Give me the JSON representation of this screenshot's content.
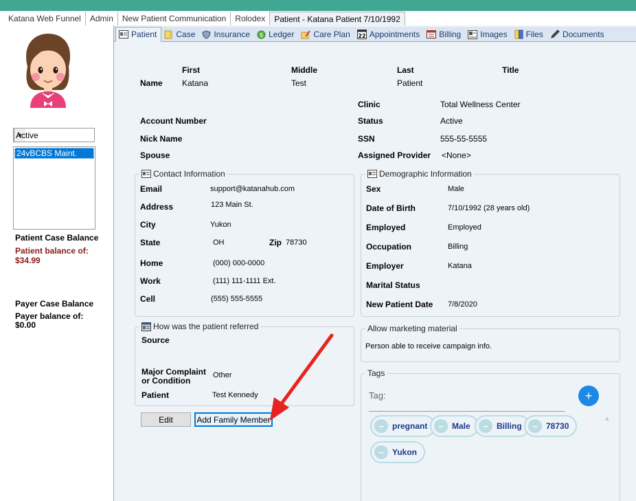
{
  "top_tabs": [
    {
      "label": "Katana Web Funnel"
    },
    {
      "label": "Admin"
    },
    {
      "label": "New Patient Communication"
    },
    {
      "label": "Rolodex"
    },
    {
      "label": "Patient - Katana Patient 7/10/1992"
    }
  ],
  "sidebar": {
    "status_value": "Active",
    "cases": [
      "24vBCBS Maint."
    ],
    "patient_balance_title": "Patient Case Balance",
    "patient_balance_text": "Patient balance of: $34.99",
    "payer_balance_title": "Payer Case Balance",
    "payer_balance_text": "Payer balance of: $0.00"
  },
  "sub_tabs": [
    {
      "label": "Patient",
      "icon": "id-card-icon"
    },
    {
      "label": "Case",
      "icon": "folder-icon"
    },
    {
      "label": "Insurance",
      "icon": "shield-icon"
    },
    {
      "label": "Ledger",
      "icon": "money-icon"
    },
    {
      "label": "Care Plan",
      "icon": "care-plan-icon"
    },
    {
      "label": "Appointments",
      "icon": "calendar-icon"
    },
    {
      "label": "Billing",
      "icon": "billing-icon"
    },
    {
      "label": "Images",
      "icon": "image-icon"
    },
    {
      "label": "Files",
      "icon": "files-icon"
    },
    {
      "label": "Documents",
      "icon": "pen-icon"
    }
  ],
  "name_block": {
    "first_header": "First",
    "middle_header": "Middle",
    "last_header": "Last",
    "title_header": "Title",
    "name_label": "Name",
    "first": "Katana",
    "middle": "Test",
    "last": "Patient"
  },
  "account": {
    "account_number_label": "Account Number",
    "nick_name_label": "Nick Name",
    "spouse_label": "Spouse",
    "clinic_label": "Clinic",
    "clinic": "Total Wellness Center",
    "status_label": "Status",
    "status": "Active",
    "ssn_label": "SSN",
    "ssn": "555-55-5555",
    "provider_label": "Assigned Provider",
    "provider": "<None>"
  },
  "contact": {
    "title": "Contact Information",
    "email_label": "Email",
    "email": "support@katanahub.com",
    "address_label": "Address",
    "address": "123 Main St.",
    "city_label": "City",
    "city": "Yukon",
    "state_label": "State",
    "state": "OH",
    "zip_label": "Zip",
    "zip": "78730",
    "home_label": "Home",
    "home": "(000) 000-0000",
    "work_label": "Work",
    "work": "(111) 111-1111 Ext.",
    "cell_label": "Cell",
    "cell": "(555) 555-5555"
  },
  "demographic": {
    "title": "Demographic Information",
    "sex_label": "Sex",
    "sex": "Male",
    "dob_label": "Date of Birth",
    "dob": "7/10/1992 (28 years old)",
    "employed_label": "Employed",
    "employed": "Employed",
    "occupation_label": "Occupation",
    "occupation": "Billing",
    "employer_label": "Employer",
    "employer": "Katana",
    "marital_label": "Marital Status",
    "new_patient_label": "New Patient Date",
    "new_patient": "7/8/2020"
  },
  "referral": {
    "title": "How was the patient referred",
    "source_label": "Source",
    "complaint_label_1": "Major Complaint",
    "complaint_label_2": "or Condition",
    "complaint": "Other",
    "patient_label": "Patient",
    "patient": "Test Kennedy"
  },
  "marketing": {
    "title": "Allow marketing material",
    "text": "Person able to receive campaign info."
  },
  "tags": {
    "title": "Tags",
    "input_label": "Tag:",
    "add_label": "+",
    "items": [
      "pregnant",
      "Male",
      "Billing",
      "78730",
      "Yukon"
    ]
  },
  "buttons": {
    "edit": "Edit",
    "add_family": "Add Family Member"
  },
  "colors": {
    "accent": "#42a792",
    "annotation_arrow": "#e8231f",
    "balance_red": "#8b1a1a",
    "tag_add": "#1e88e5"
  }
}
